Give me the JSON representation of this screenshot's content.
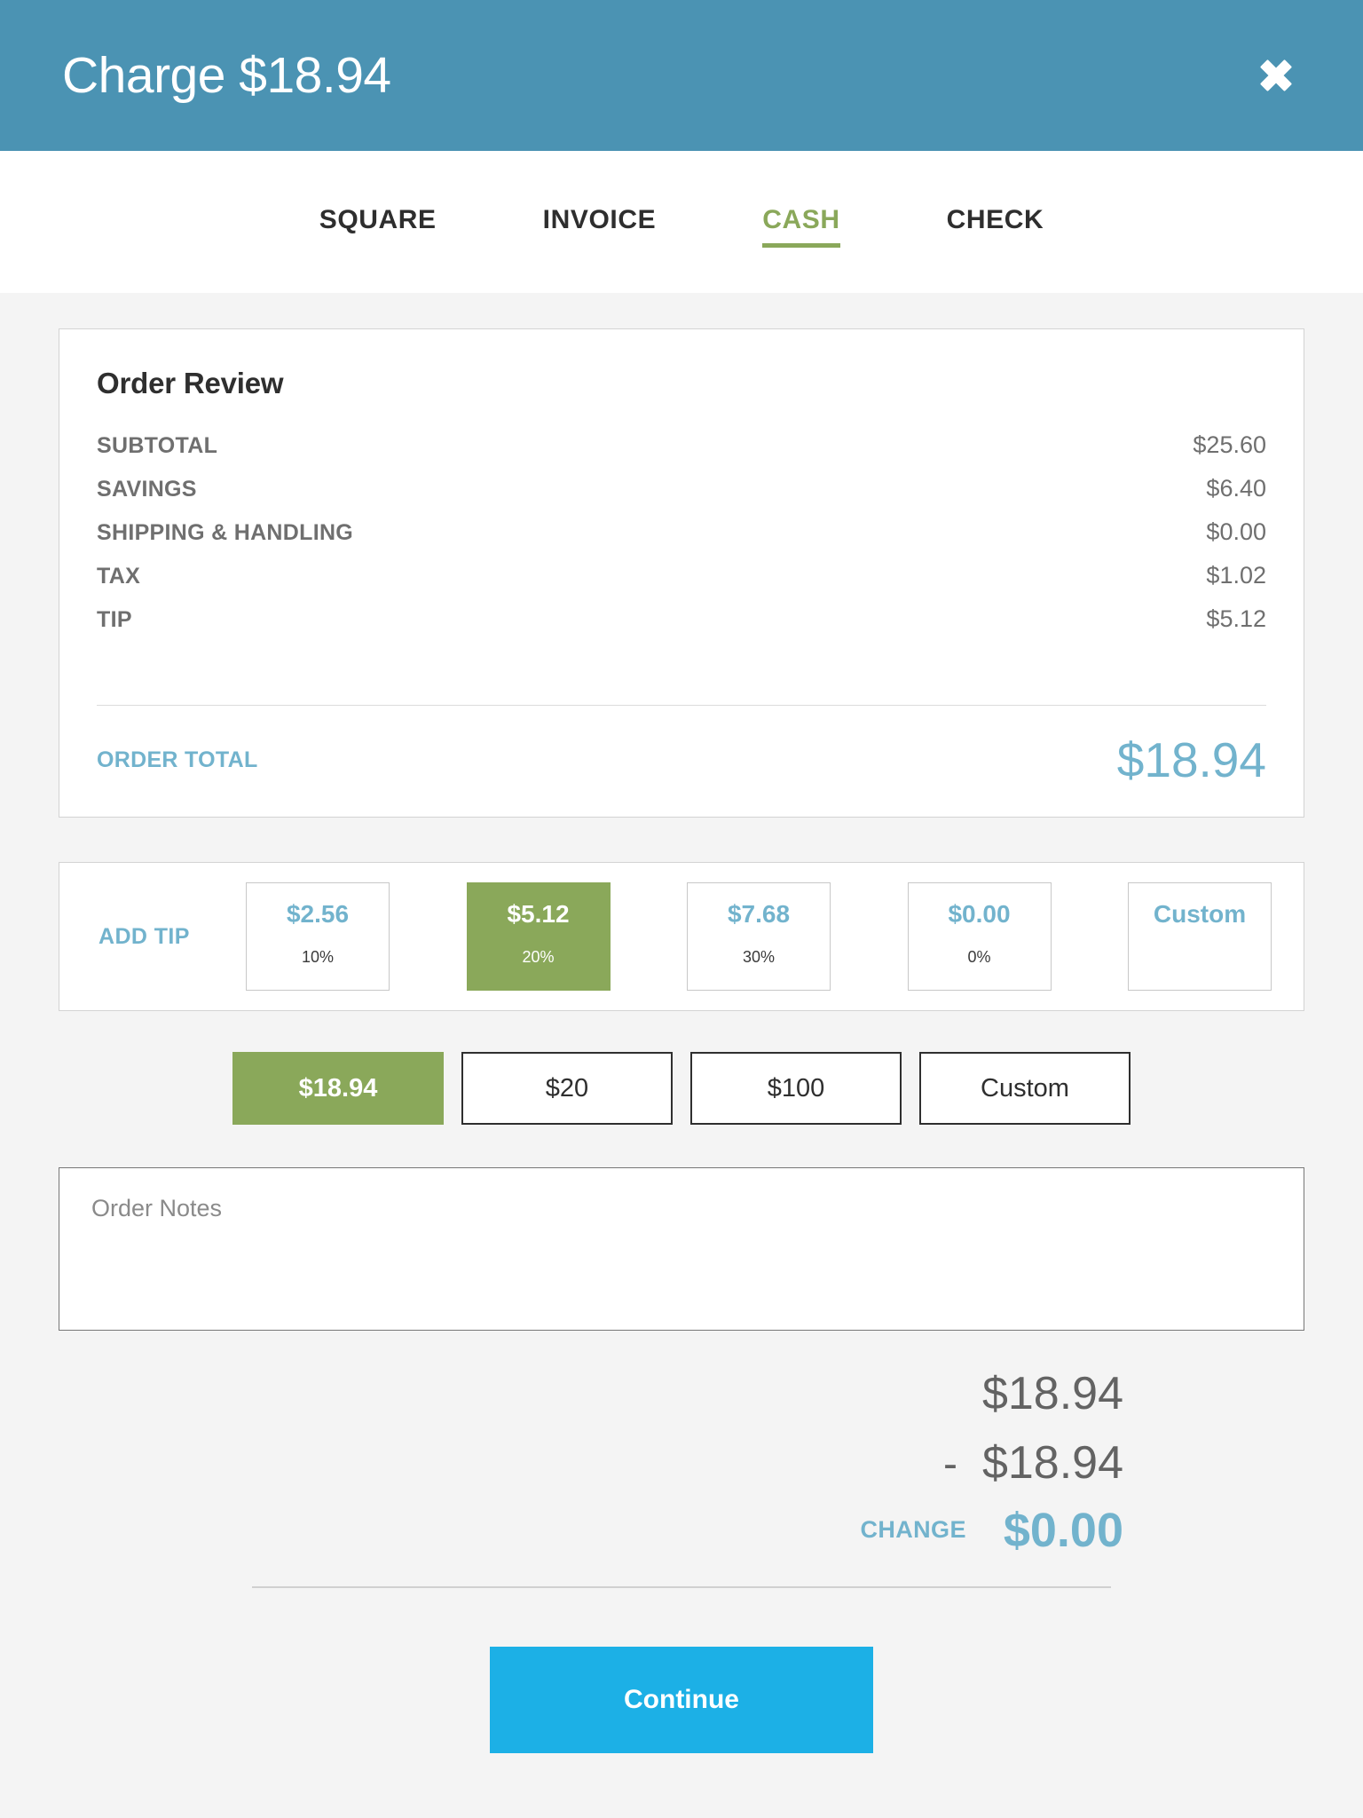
{
  "header": {
    "title": "Charge $18.94",
    "close_icon": "close-x-icon",
    "background_color": "#4b93b3"
  },
  "tabs": [
    {
      "label": "SQUARE",
      "active": false
    },
    {
      "label": "INVOICE",
      "active": false
    },
    {
      "label": "CASH",
      "active": true
    },
    {
      "label": "CHECK",
      "active": false
    }
  ],
  "order_review": {
    "title": "Order Review",
    "rows": [
      {
        "label": "SUBTOTAL",
        "value": "$25.60"
      },
      {
        "label": "SAVINGS",
        "value": "$6.40"
      },
      {
        "label": "SHIPPING & HANDLING",
        "value": "$0.00"
      },
      {
        "label": "TAX",
        "value": "$1.02"
      },
      {
        "label": "TIP",
        "value": "$5.12"
      }
    ],
    "total_label": "ORDER TOTAL",
    "total_value": "$18.94"
  },
  "tip": {
    "label": "ADD TIP",
    "options": [
      {
        "amount": "$2.56",
        "percent": "10%",
        "selected": false
      },
      {
        "amount": "$5.12",
        "percent": "20%",
        "selected": true
      },
      {
        "amount": "$7.68",
        "percent": "30%",
        "selected": false
      },
      {
        "amount": "$0.00",
        "percent": "0%",
        "selected": false
      },
      {
        "amount": "Custom",
        "percent": "",
        "selected": false
      }
    ]
  },
  "cash_amounts": [
    {
      "label": "$18.94",
      "selected": true
    },
    {
      "label": "$20",
      "selected": false
    },
    {
      "label": "$100",
      "selected": false
    },
    {
      "label": "Custom",
      "selected": false
    }
  ],
  "notes": {
    "placeholder": "Order Notes",
    "value": ""
  },
  "calculation": {
    "tendered": "$18.94",
    "minus_sign": "-",
    "due": "$18.94",
    "change_label": "CHANGE",
    "change_value": "$0.00"
  },
  "footer": {
    "continue_label": "Continue"
  },
  "colors": {
    "header_blue": "#4b93b3",
    "accent_blue": "#72b3cd",
    "selected_green": "#8aa85a",
    "continue_blue": "#1cb0e6",
    "page_background": "#f4f4f4"
  }
}
